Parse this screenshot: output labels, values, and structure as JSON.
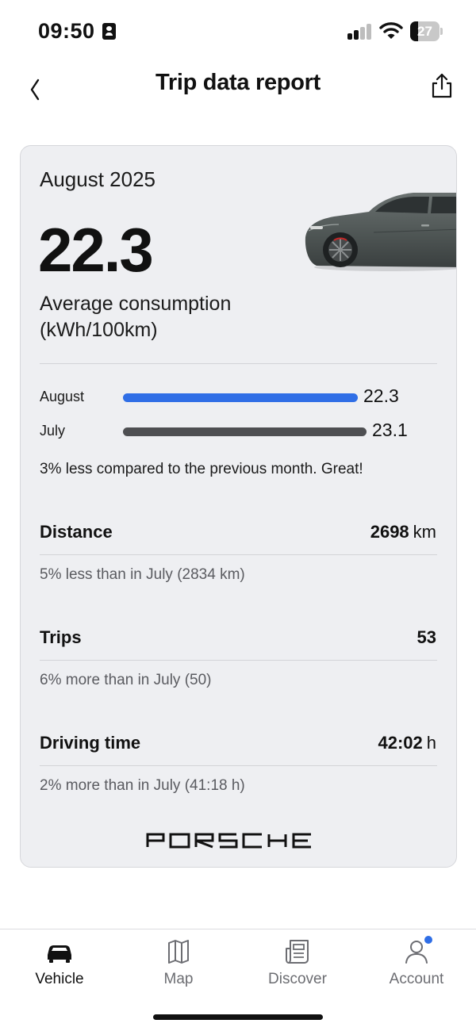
{
  "status_bar": {
    "time": "09:50",
    "battery": "27",
    "battery_level": 0.27,
    "icons": [
      "contact-card-icon",
      "cellular-signal-icon",
      "wifi-icon",
      "battery-icon"
    ]
  },
  "header": {
    "title": "Trip data report",
    "back_icon": "chevron-left-icon",
    "share_icon": "share-icon"
  },
  "report": {
    "month": "August 2025",
    "average_value": "22.3",
    "average_label_line1": "Average consumption",
    "average_label_line2": "(kWh/100km)",
    "comparison": [
      {
        "label": "August",
        "value": "22.3",
        "amount": 22.3,
        "color": "#2f6ee6"
      },
      {
        "label": "July",
        "value": "23.1",
        "amount": 23.1,
        "color": "#4e4f52"
      }
    ],
    "comparison_note": "3% less compared to the previous month. Great!",
    "stats": [
      {
        "label": "Distance",
        "value": "2698",
        "unit": "km",
        "sub": "5% less than in July (2834 km)"
      },
      {
        "label": "Trips",
        "value": "53",
        "unit": "",
        "sub": "6% more than in July (50)"
      },
      {
        "label": "Driving time",
        "value": "42:02",
        "unit": "h",
        "sub": "2% more than in July (41:18 h)"
      }
    ],
    "brand": "PORSCHE"
  },
  "tab_bar": {
    "tabs": [
      {
        "label": "Vehicle",
        "icon": "car-icon",
        "active": true
      },
      {
        "label": "Map",
        "icon": "map-icon",
        "active": false
      },
      {
        "label": "Discover",
        "icon": "news-icon",
        "active": false
      },
      {
        "label": "Account",
        "icon": "person-icon",
        "active": false,
        "badge": true
      }
    ]
  },
  "colors": {
    "accent": "#2f6ee6",
    "card_background": "#eeeff2",
    "previous_month_bar": "#4e4f52"
  }
}
